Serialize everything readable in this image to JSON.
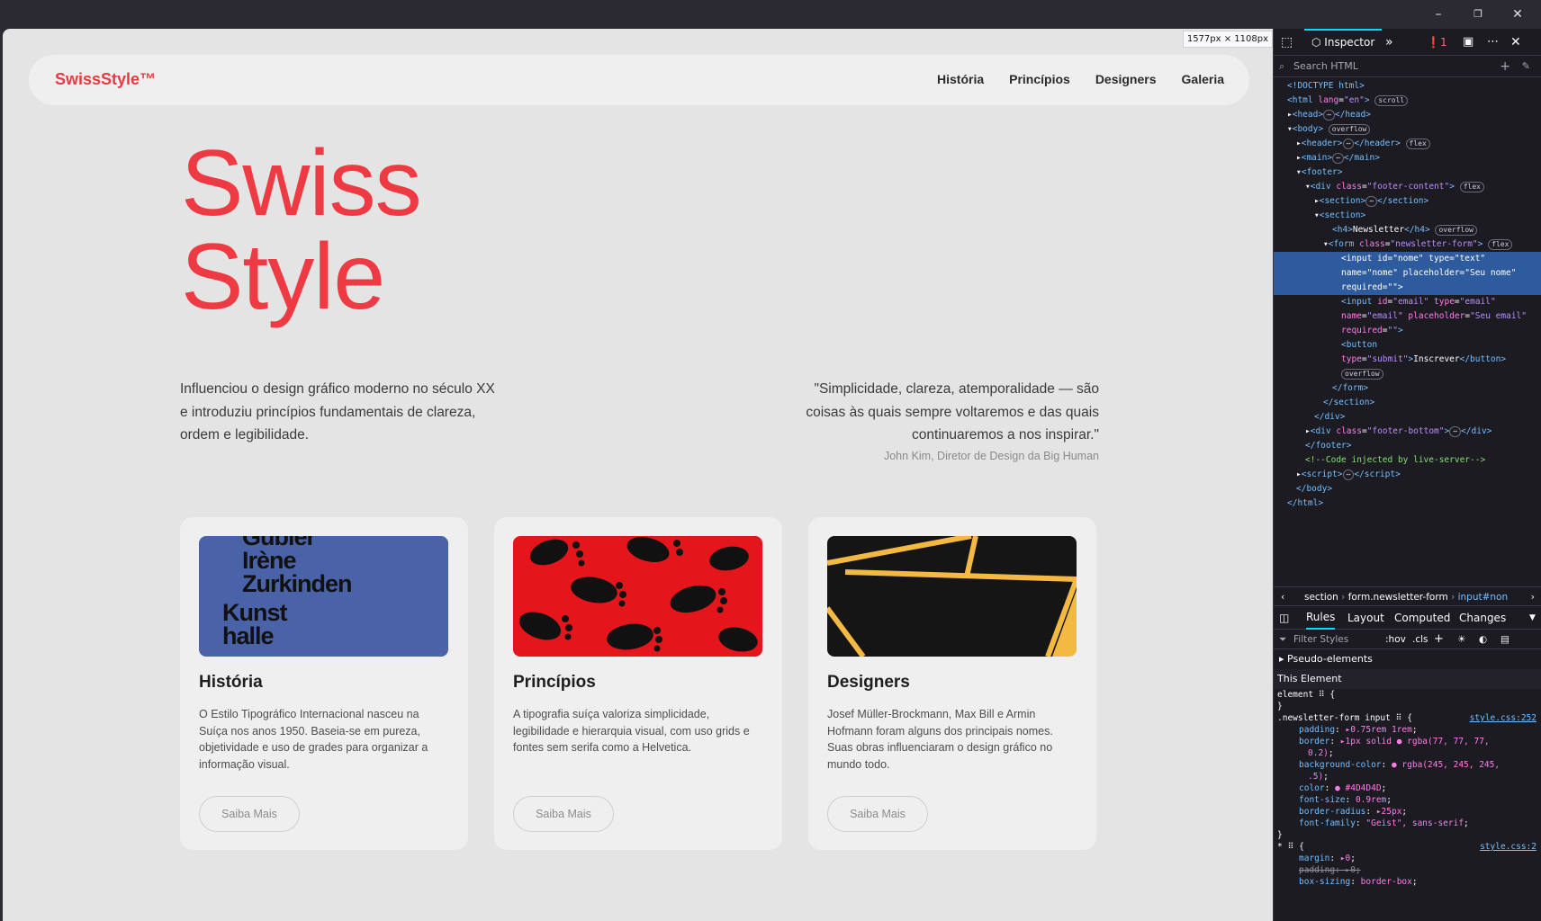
{
  "window": {
    "minimize": "–",
    "restore": "❐",
    "close": "✕"
  },
  "viewport_size": "1577px × 1108px",
  "site": {
    "brand": "SwissStyle™",
    "nav": [
      "História",
      "Princípios",
      "Designers",
      "Galeria"
    ],
    "hero": [
      "Swiss",
      "Style"
    ],
    "intro": "Influenciou o design gráfico moderno no século XX e introduziu princípios fundamentais de clareza, ordem e legibilidade.",
    "quote": "\"Simplicidade, clareza, atemporalidade — são coisas às quais sempre voltaremos e das quais continuaremos a nos inspirar.\"",
    "quote_author": "John Kim, Diretor de Design da Big Human",
    "cards": [
      {
        "title": "História",
        "text": "O Estilo Tipográfico Internacional nasceu na Suíça nos anos 1950. Baseia-se em pureza, objetividade e uso de grades para organizar a informação visual.",
        "button": "Saiba Mais",
        "poster_lines": [
          "Gubler",
          "Irène",
          "Zurkinden",
          "Kunst",
          "halle"
        ]
      },
      {
        "title": "Princípios",
        "text": "A tipografia suíça valoriza simplicidade, legibilidade e hierarquia visual, com uso grids e fontes sem serifa como a Helvetica.",
        "button": "Saiba Mais"
      },
      {
        "title": "Designers",
        "text": "Josef Müller-Brockmann, Max Bill e Armin Hofmann foram alguns dos principais nomes. Suas obras influenciaram o design gráfico no mundo todo.",
        "button": "Saiba Mais"
      }
    ]
  },
  "devtools": {
    "tab": "Inspector",
    "error_count": "1",
    "search_placeholder": "Search HTML",
    "breadcrumbs": [
      "section",
      "form.newsletter-form",
      "input#non"
    ],
    "panel_tabs": [
      "Rules",
      "Layout",
      "Computed",
      "Changes"
    ],
    "filter_placeholder": "Filter Styles",
    "hov": ":hov",
    "cls": ".cls",
    "pseudo": "Pseudo-elements",
    "this_element": "This Element",
    "rule_source": "style.css:252",
    "rule_source2": "style.css:2"
  }
}
